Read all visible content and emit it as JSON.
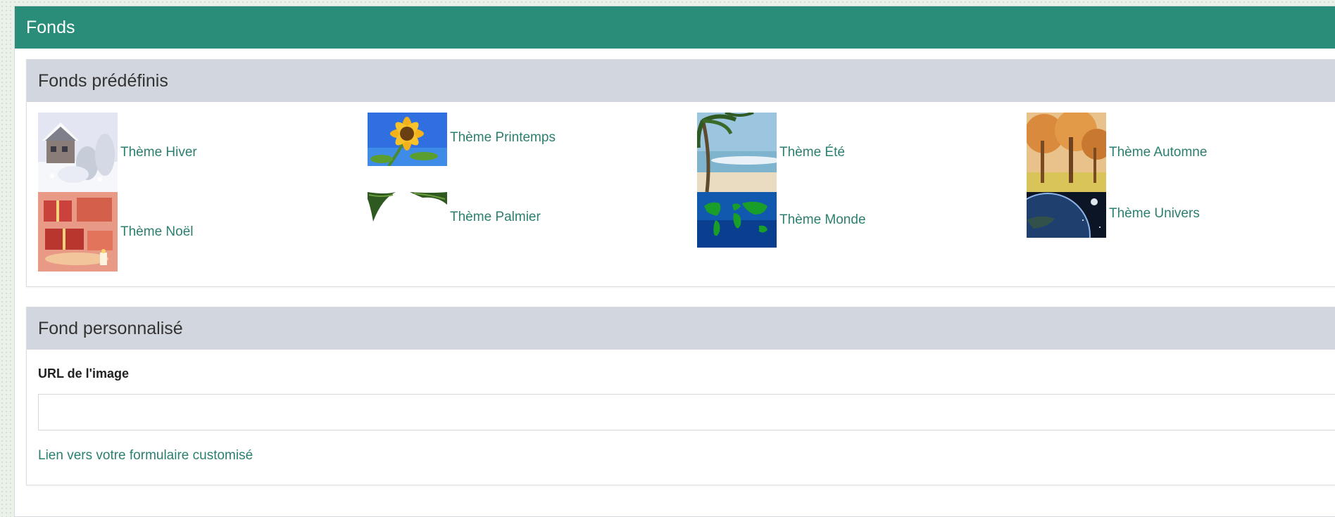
{
  "page": {
    "title": "Fonds"
  },
  "predefined": {
    "title": "Fonds prédéfinis",
    "themes": [
      {
        "label": "Thème Hiver",
        "thumbnail": "winter-chalet-icon"
      },
      {
        "label": "Thème Printemps",
        "thumbnail": "sunflower-icon"
      },
      {
        "label": "Thème Été",
        "thumbnail": "beach-palm-icon"
      },
      {
        "label": "Thème Automne",
        "thumbnail": "autumn-trees-icon"
      },
      {
        "label": "Thème Noël",
        "thumbnail": "christmas-gifts-icon"
      },
      {
        "label": "Thème Palmier",
        "thumbnail": "palm-leaves-icon"
      },
      {
        "label": "Thème Monde",
        "thumbnail": "world-map-icon"
      },
      {
        "label": "Thème Univers",
        "thumbnail": "earth-space-icon"
      }
    ]
  },
  "custom": {
    "title": "Fond personnalisé",
    "url_label": "URL de l'image",
    "url_value": "",
    "url_placeholder": "",
    "link_label": "Lien vers votre formulaire customisé"
  },
  "colors": {
    "header_bg": "#2a8d7a",
    "panel_header_bg": "#d2d6de",
    "link": "#2a7f6e"
  }
}
